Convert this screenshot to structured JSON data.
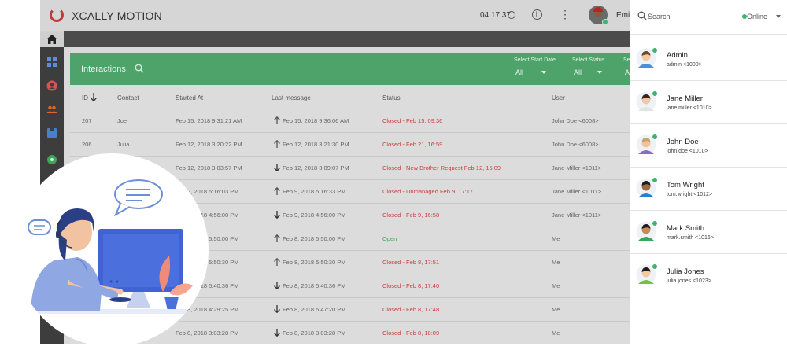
{
  "app": {
    "title": "XCALLY MOTION",
    "clock": "04:17:37",
    "user_name": "Emil"
  },
  "panel": {
    "title": "Interactions",
    "filters": [
      {
        "label": "Select Start Date",
        "value": "All"
      },
      {
        "label": "Select Status",
        "value": "All"
      },
      {
        "label": "Se",
        "value": "A"
      }
    ],
    "columns": [
      "ID",
      "Contact",
      "Started At",
      "Last message",
      "Status",
      "User"
    ]
  },
  "rows": [
    {
      "id": "207",
      "contact": "Joe",
      "started": "Feb 15, 2018 9:31:21 AM",
      "last_dir": "up",
      "last": "Feb 15, 2018 9:36:06 AM",
      "status": "Closed - Feb 15, 09:36",
      "status_kind": "closed",
      "user": "John Doe <6008>"
    },
    {
      "id": "206",
      "contact": "Julia",
      "started": "Feb 12, 2018 3:20:22 PM",
      "last_dir": "up",
      "last": "Feb 12, 2018 3:21:30 PM",
      "status": "Closed - Feb 21, 16:59",
      "status_kind": "closed",
      "user": "John Doe <6008>"
    },
    {
      "id": "",
      "contact": "",
      "started": "Feb 12, 2018 3:03:57 PM",
      "last_dir": "down",
      "last": "Feb 12, 2018 3:09:07 PM",
      "status": "Closed - New Brother Request Feb 12, 15:09",
      "status_kind": "closed",
      "user": "Jane Miller <1011>"
    },
    {
      "id": "",
      "contact": "",
      "started": "Feb 9, 2018 5:16:03 PM",
      "last_dir": "up",
      "last": "Feb 9, 2018 5:16:33 PM",
      "status": "Closed - Unmanaged Feb 9, 17:17",
      "status_kind": "closed",
      "user": "Jane Miller <1011>"
    },
    {
      "id": "",
      "contact": "",
      "started": "Feb 9, 2018 4:56:00 PM",
      "last_dir": "down",
      "last": "Feb 9, 2018 4:56:00 PM",
      "status": "Closed - Feb 9, 16:58",
      "status_kind": "closed",
      "user": "Jane Miller <1011>"
    },
    {
      "id": "",
      "contact": "",
      "started": "Feb 8, 2018 5:50:00 PM",
      "last_dir": "up",
      "last": "Feb 8, 2018 5:50:00 PM",
      "status": "Open",
      "status_kind": "open",
      "user": "Me"
    },
    {
      "id": "",
      "contact": "",
      "started": "Feb 8, 2018 5:50:30 PM",
      "last_dir": "up",
      "last": "Feb 8, 2018 5:50:30 PM",
      "status": "Closed - Feb 8, 17:51",
      "status_kind": "closed",
      "user": "Me"
    },
    {
      "id": "",
      "contact": "",
      "started": "Feb 8, 2018 5:40:36 PM",
      "last_dir": "down",
      "last": "Feb 8, 2018 5:40:36 PM",
      "status": "Closed - Feb 8, 17:40",
      "status_kind": "closed",
      "user": "Me"
    },
    {
      "id": "",
      "contact": "",
      "started": "Feb 8, 2018 4:29:25 PM",
      "last_dir": "down",
      "last": "Feb 8, 2018 5:47:20 PM",
      "status": "Closed - Feb 8, 17:48",
      "status_kind": "closed",
      "user": "Me"
    },
    {
      "id": "",
      "contact": "",
      "started": "Feb 8, 2018 3:03:28 PM",
      "last_dir": "down",
      "last": "Feb 8, 2018 3:03:28 PM",
      "status": "Closed - Feb 8, 18:09",
      "status_kind": "closed",
      "user": "Me"
    }
  ],
  "pane": {
    "search_placeholder": "Search",
    "presence": "Online",
    "contacts": [
      {
        "name": "Admin",
        "ext": "admin <1000>",
        "avatar": "man-brown-hair",
        "shirt": "#4a90d9",
        "hair": "#6b4a2b",
        "skin": "#f3c9a0"
      },
      {
        "name": "Jane Miller",
        "ext": "jane.miller <1010>",
        "avatar": "woman-dark-hair",
        "shirt": "#e3e3e3",
        "hair": "#3a2418",
        "skin": "#f2c6a6"
      },
      {
        "name": "John Doe",
        "ext": "john.doe <1010>",
        "avatar": "man-glasses-beard",
        "shirt": "#8e6bbf",
        "hair": "#c9a46b",
        "skin": "#f0c39b"
      },
      {
        "name": "Tom Wright",
        "ext": "tom.wright <1012>",
        "avatar": "man-dark-skin",
        "shirt": "#2d7fc9",
        "hair": "#1d1d1d",
        "skin": "#9b6a44"
      },
      {
        "name": "Mark Smith",
        "ext": "mark.smith <1016>",
        "avatar": "man-sunglasses",
        "shirt": "#3aa657",
        "hair": "#1d1d1d",
        "skin": "#c98a5a"
      },
      {
        "name": "Julia Jones",
        "ext": "julia.jones <1023>",
        "avatar": "woman-green-shirt",
        "shirt": "#74c043",
        "hair": "#1d1d1d",
        "skin": "#f3c9a0"
      }
    ]
  }
}
